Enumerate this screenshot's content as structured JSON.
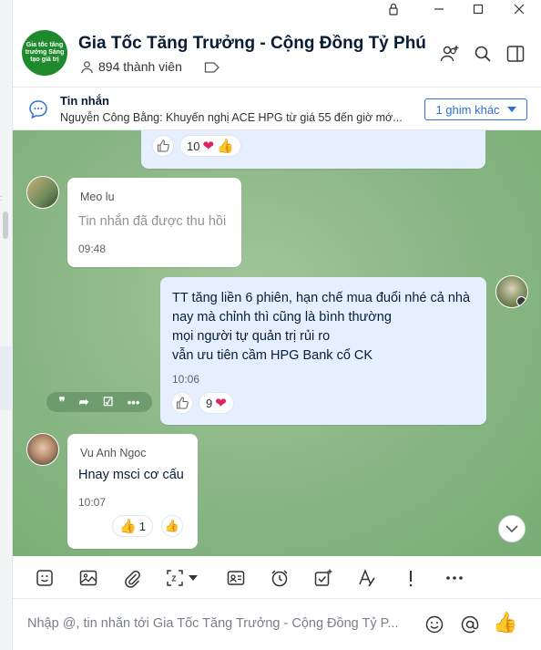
{
  "window": {
    "lock_icon": "lock-icon",
    "min_icon": "minimize-icon",
    "max_icon": "maximize-icon",
    "close_icon": "close-icon"
  },
  "left_strip": {
    "mark": ":"
  },
  "header": {
    "avatar_text": "Gia tốc tăng trưởng Sáng tạo giá trị",
    "title": "Gia Tốc Tăng Trưởng - Cộng Đồng Tỷ Phú",
    "members": "894 thành viên",
    "icons": [
      "add-member-icon",
      "search-icon",
      "sidebar-toggle-icon"
    ]
  },
  "pinned": {
    "title": "Tin nhắn",
    "text": "Nguyễn Công Bằng: Khuyến nghị ACE HPG từ giá 55 đến giờ mớ...",
    "more_button": "1 ghim khác"
  },
  "messages": {
    "m0": {
      "reaction_count": "10"
    },
    "m1": {
      "sender": "Meo lu",
      "text": "Tin nhắn đã được thu hồi",
      "time": "09:48"
    },
    "m2": {
      "lines": [
        "TT tăng liền 6 phiên, hạn chế mua đuổi nhé cả nhà",
        "nay mà chỉnh thì cũng là bình thường",
        "mọi người tự quản trị rủi ro",
        "vẫn ưu tiên cầm HPG Bank cổ CK"
      ],
      "time": "10:06",
      "reaction_count": "9"
    },
    "m3": {
      "sender": "Vu Anh Ngoc",
      "text": "Hnay msci cơ cấu",
      "time": "10:07",
      "reaction_count": "1"
    }
  },
  "toolbar": {
    "icons": [
      "sticker-icon",
      "image-icon",
      "attachment-icon",
      "screenshot-icon",
      "contact-card-icon",
      "reminder-icon",
      "todo-icon",
      "format-text-icon",
      "important-icon",
      "more-icon"
    ]
  },
  "composer": {
    "placeholder": "Nhập @, tin nhắn tới Gia Tốc Tăng Trưởng - Cộng Đồng Tỷ P...",
    "icons": [
      "emoji-icon",
      "mention-icon",
      "quick-like-icon"
    ]
  },
  "colors": {
    "accent": "#2f6fd6",
    "chat_bg": "#8cb887",
    "outgoing_bubble": "#e5efff"
  }
}
